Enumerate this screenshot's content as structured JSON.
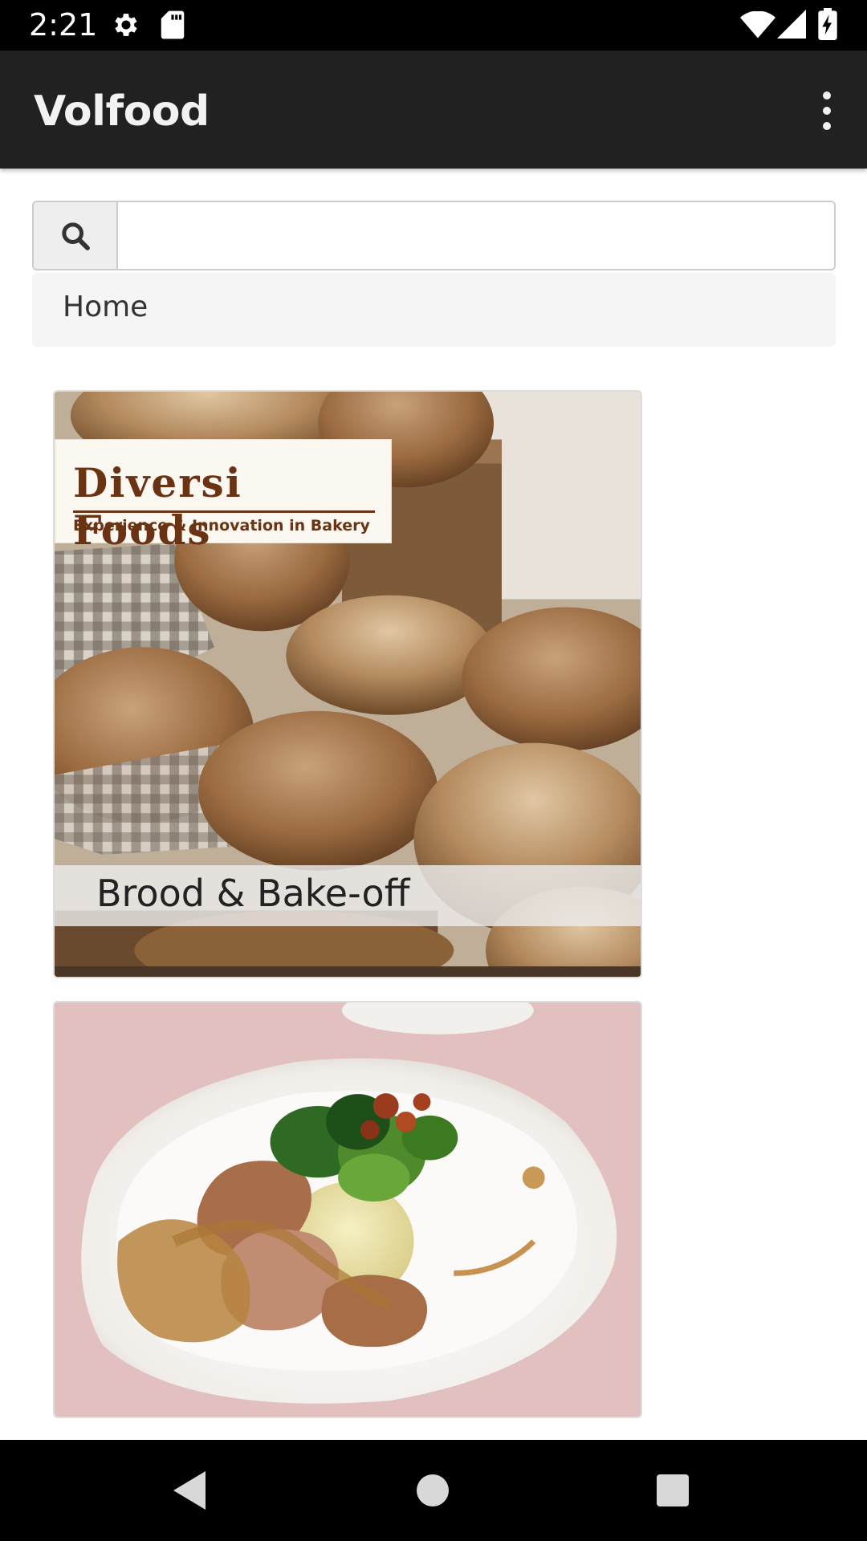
{
  "status_bar": {
    "time": "2:21",
    "left_icons": [
      "settings-icon",
      "sd-card-icon"
    ],
    "right_icons": [
      "wifi-icon",
      "signal-icon",
      "battery-charging-icon"
    ]
  },
  "app_bar": {
    "title": "Volfood",
    "menu_icon": "more-vert-icon",
    "background": "#212121"
  },
  "search": {
    "icon": "search-icon",
    "value": "",
    "placeholder": ""
  },
  "breadcrumb": {
    "items": [
      "Home"
    ]
  },
  "cards": [
    {
      "image_logo": {
        "name": "Diversi Foods",
        "tagline": "Experience & Innovation in Bakery"
      },
      "caption": "Brood & Bake-off"
    },
    {
      "caption": ""
    }
  ],
  "nav_bar": {
    "buttons": [
      "back-icon",
      "home-icon",
      "recents-icon"
    ]
  }
}
